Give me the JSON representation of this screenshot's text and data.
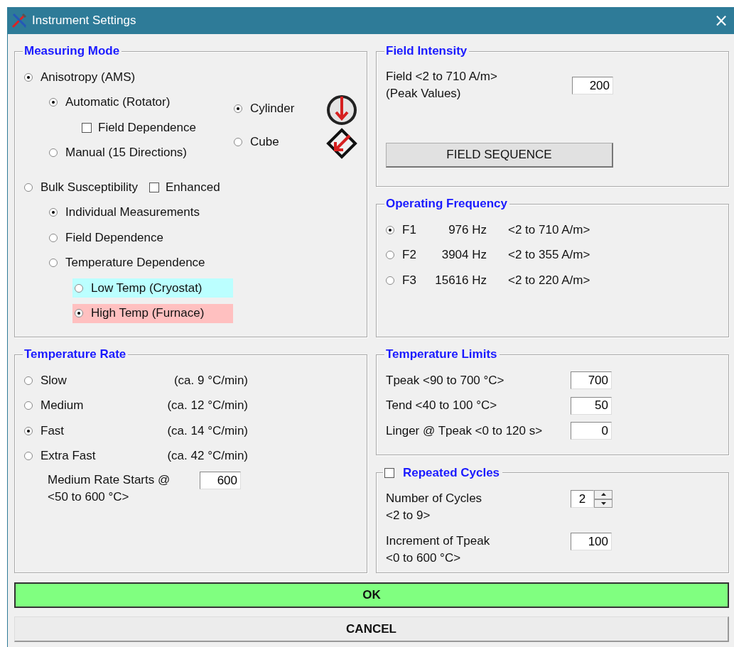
{
  "window": {
    "title": "Instrument Settings",
    "close": "×"
  },
  "measuring_mode": {
    "title": "Measuring Mode",
    "anisotropy": {
      "label": "Anisotropy (AMS)",
      "selected": true,
      "methods": [
        {
          "label": "Automatic (Rotator)",
          "selected": true
        },
        {
          "label": "Manual (15 Directions)",
          "selected": false
        }
      ],
      "field_dependence": {
        "label": "Field Dependence",
        "checked": false
      },
      "shapes": [
        {
          "label": "Cylinder",
          "selected": true,
          "kind": "cylinder"
        },
        {
          "label": "Cube",
          "selected": false,
          "kind": "cube"
        }
      ]
    },
    "bulk": {
      "label": "Bulk Susceptibility",
      "selected": false,
      "enhanced": {
        "label": "Enhanced",
        "checked": false
      },
      "types": [
        {
          "label": "Individual Measurements",
          "selected": true
        },
        {
          "label": "Field Dependence",
          "selected": false
        },
        {
          "label": "Temperature Dependence",
          "selected": false
        }
      ],
      "temp_options": [
        {
          "label": "Low Temp (Cryostat)",
          "selected": false,
          "color": "#bbffff"
        },
        {
          "label": "High Temp (Furnace)",
          "selected": true,
          "color": "#ffc0c0"
        }
      ]
    }
  },
  "temperature_rate": {
    "title": "Temperature Rate",
    "rates": [
      {
        "label": "Slow",
        "rate": "(ca. 9 °C/min)",
        "selected": false
      },
      {
        "label": "Medium",
        "rate": "(ca. 12 °C/min)",
        "selected": false
      },
      {
        "label": "Fast",
        "rate": "(ca. 14 °C/min)",
        "selected": true
      },
      {
        "label": "Extra Fast",
        "rate": "(ca. 42 °C/min)",
        "selected": false
      }
    ],
    "medium_start": {
      "label": "Medium Rate Starts @\n<50 to 600 °C>",
      "value": "600"
    }
  },
  "field_intensity": {
    "title": "Field Intensity",
    "field": {
      "label": "Field <2 to 710 A/m>\n(Peak Values)",
      "value": "200"
    },
    "button": "FIELD SEQUENCE"
  },
  "operating_frequency": {
    "title": "Operating Frequency",
    "frequencies": [
      {
        "label": "F1",
        "frequency": "976 Hz",
        "range": "<2 to 710 A/m>",
        "selected": true
      },
      {
        "label": "F2",
        "frequency": "3904 Hz",
        "range": "<2 to 355 A/m>",
        "selected": false
      },
      {
        "label": "F3",
        "frequency": "15616 Hz",
        "range": "<2 to 220 A/m>",
        "selected": false
      }
    ]
  },
  "temperature_limits": {
    "title": "Temperature Limits",
    "fields": [
      {
        "label": "Tpeak <90 to 700 °C>",
        "value": "700"
      },
      {
        "label": "Tend <40 to 100 °C>",
        "value": "50"
      },
      {
        "label": "Linger @ Tpeak <0 to 120 s>",
        "value": "0"
      }
    ]
  },
  "repeated_cycles": {
    "title": "Repeated Cycles",
    "checked": false,
    "fields": [
      {
        "label": "Number of Cycles\n<2 to 9>",
        "value": "2",
        "kind": "spinner"
      },
      {
        "label": "Increment of Tpeak\n<0 to 600 °C>",
        "value": "100",
        "kind": "text"
      }
    ]
  },
  "buttons": [
    {
      "label": "OK",
      "kind": "primary"
    },
    {
      "label": "CANCEL",
      "kind": "normal"
    }
  ]
}
